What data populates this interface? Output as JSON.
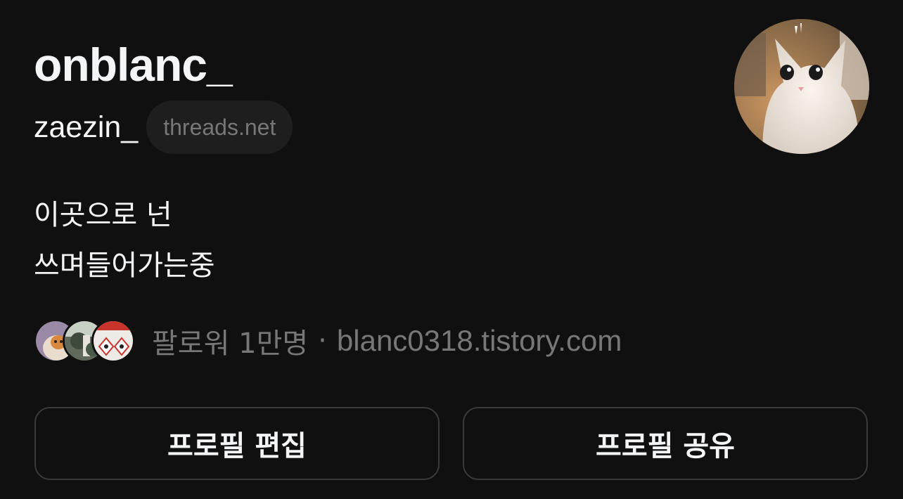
{
  "profile": {
    "display_name": "onblanc_",
    "username": "zaezin_",
    "domain_badge": "threads.net",
    "avatar_icon": "cat-photo",
    "bio_lines": [
      "이곳으로 넌",
      "쓰며들어가는중"
    ],
    "followers_label": "팔로워 1만명",
    "separator": "·",
    "link": "blanc0318.tistory.com",
    "follower_avatars": [
      "cat-photo",
      "outdoor-photo",
      "danger-sign-photo"
    ]
  },
  "actions": {
    "edit_profile": "프로필 편집",
    "share_profile": "프로필 공유"
  },
  "colors": {
    "background": "#101010",
    "primary_text": "#f3f5f7",
    "secondary_text": "#777777",
    "pill_background": "#1e1e1e",
    "button_border": "#3a3a3a"
  }
}
